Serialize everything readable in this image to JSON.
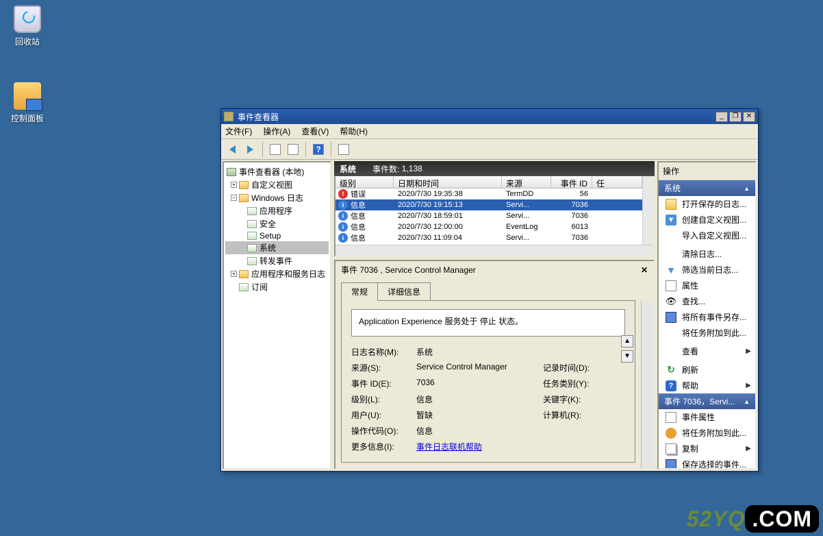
{
  "desktop": {
    "recycle": "回收站",
    "control_panel": "控制面板"
  },
  "window": {
    "title": "事件查看器",
    "min": "_",
    "restore": "❐",
    "close": "✕"
  },
  "menu": {
    "file": "文件(F)",
    "action": "操作(A)",
    "view": "查看(V)",
    "help": "帮助(H)"
  },
  "tree": {
    "root": "事件查看器 (本地)",
    "custom_views": "自定义视图",
    "windows_logs": "Windows 日志",
    "application": "应用程序",
    "security": "安全",
    "setup": "Setup",
    "system": "系统",
    "forwarded": "转发事件",
    "app_service_logs": "应用程序和服务日志",
    "subscriptions": "订阅"
  },
  "list": {
    "header_title": "系统",
    "header_count_label": "事件数:",
    "header_count": "1,138",
    "columns": {
      "level": "级别",
      "datetime": "日期和时间",
      "source": "来源",
      "event_id": "事件 ID",
      "task": "任"
    },
    "rows": [
      {
        "level_icon": "err",
        "level": "错误",
        "datetime": "2020/7/30 19:35:38",
        "source": "TermDD",
        "id": "56"
      },
      {
        "level_icon": "info",
        "level": "信息",
        "datetime": "2020/7/30 19:15:13",
        "source": "Servi...",
        "id": "7036",
        "selected": true
      },
      {
        "level_icon": "info",
        "level": "信息",
        "datetime": "2020/7/30 18:59:01",
        "source": "Servi...",
        "id": "7036"
      },
      {
        "level_icon": "info",
        "level": "信息",
        "datetime": "2020/7/30 12:00:00",
        "source": "EventLog",
        "id": "6013"
      },
      {
        "level_icon": "info",
        "level": "信息",
        "datetime": "2020/7/30 11:09:04",
        "source": "Servi...",
        "id": "7036"
      }
    ]
  },
  "detail": {
    "title": "事件 7036 , Service Control Manager",
    "tabs": {
      "general": "常规",
      "details": "详细信息"
    },
    "message": "Application Experience 服务处于 停止 状态。",
    "labels": {
      "log_name": "日志名称(M):",
      "log_name_v": "系统",
      "source": "来源(S):",
      "source_v": "Service Control Manager",
      "logged": "记录时间(D):",
      "event_id": "事件 ID(E):",
      "event_id_v": "7036",
      "task_cat": "任务类别(Y):",
      "level": "级别(L):",
      "level_v": "信息",
      "keywords": "关键字(K):",
      "user": "用户(U):",
      "user_v": "暂缺",
      "computer": "计算机(R):",
      "opcode": "操作代码(O):",
      "opcode_v": "信息",
      "more_info": "更多信息(I):",
      "more_info_link": "事件日志联机帮助"
    }
  },
  "actions": {
    "header": "操作",
    "group1_title": "系统",
    "open_saved": "打开保存的日志...",
    "create_custom": "创建自定义视图...",
    "import_custom": "导入自定义视图...",
    "clear_log": "清除日志...",
    "filter_current": "筛选当前日志...",
    "properties": "属性",
    "find": "查找...",
    "save_all": "将所有事件另存...",
    "attach_task": "将任务附加到此...",
    "view": "查看",
    "refresh": "刷新",
    "help": "帮助",
    "group2_title": "事件 7036，Servi...",
    "event_props": "事件属性",
    "attach_task2": "将任务附加到此...",
    "copy": "复制",
    "save_selected": "保存选择的事件..."
  },
  "watermark": {
    "a": "52YQ",
    "b": ".COM"
  }
}
